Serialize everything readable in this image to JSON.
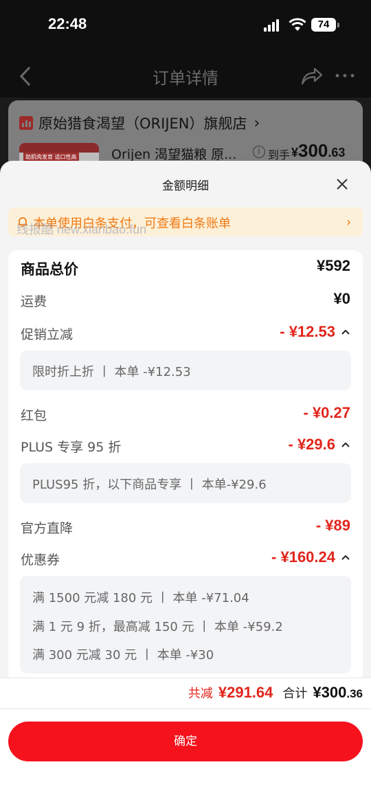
{
  "status": {
    "time": "22:48",
    "battery": "74"
  },
  "nav": {
    "title": "订单详情"
  },
  "store": {
    "name": "原始猎食渴望（ORIJEN）旗舰店"
  },
  "product": {
    "name": "Orijen 渴望猫粮 原...",
    "thumb_label": "助肌肉发育 适口性高",
    "price_label": "到手",
    "price_currency": "¥",
    "price_int": "300",
    "price_dec": ".63"
  },
  "sheet": {
    "title": "金额明细",
    "notice": "本单使用白条支付，可查看白条账单",
    "watermark": "线报酷 new.xianbao.fun",
    "rows": {
      "total": {
        "label": "商品总价",
        "value": "¥592"
      },
      "shipping": {
        "label": "运费",
        "value": "¥0"
      },
      "promo": {
        "label": "促销立减",
        "value": "- ¥12.53"
      },
      "redpacket": {
        "label": "红包",
        "value": "- ¥0.27"
      },
      "plus": {
        "label": "PLUS 专享 95 折",
        "value": "- ¥29.6"
      },
      "official": {
        "label": "官方直降",
        "value": "- ¥89"
      },
      "coupon": {
        "label": "优惠券",
        "value": "- ¥160.24"
      }
    },
    "details": {
      "promo": [
        "限时折上折  丨 本单 -¥12.53"
      ],
      "plus": [
        "PLUS95 折，以下商品专享  丨 本单-¥29.6"
      ],
      "coupon": [
        "满 1500 元减 180 元  丨 本单 -¥71.04",
        "满 1 元 9 折，最高减 150 元  丨 本单 -¥59.2",
        "满 300 元减 30 元  丨 本单 -¥30"
      ]
    }
  },
  "summary": {
    "discount_label": "共减",
    "discount_value": "¥291.64",
    "total_label": "合计",
    "total_currency": "¥",
    "total_int": "300",
    "total_dec": ".36"
  },
  "footer": {
    "confirm_label": "确定"
  },
  "colors": {
    "accent_red": "#e1251b",
    "button_red": "#f5121d",
    "notice_orange": "#f07a15"
  }
}
